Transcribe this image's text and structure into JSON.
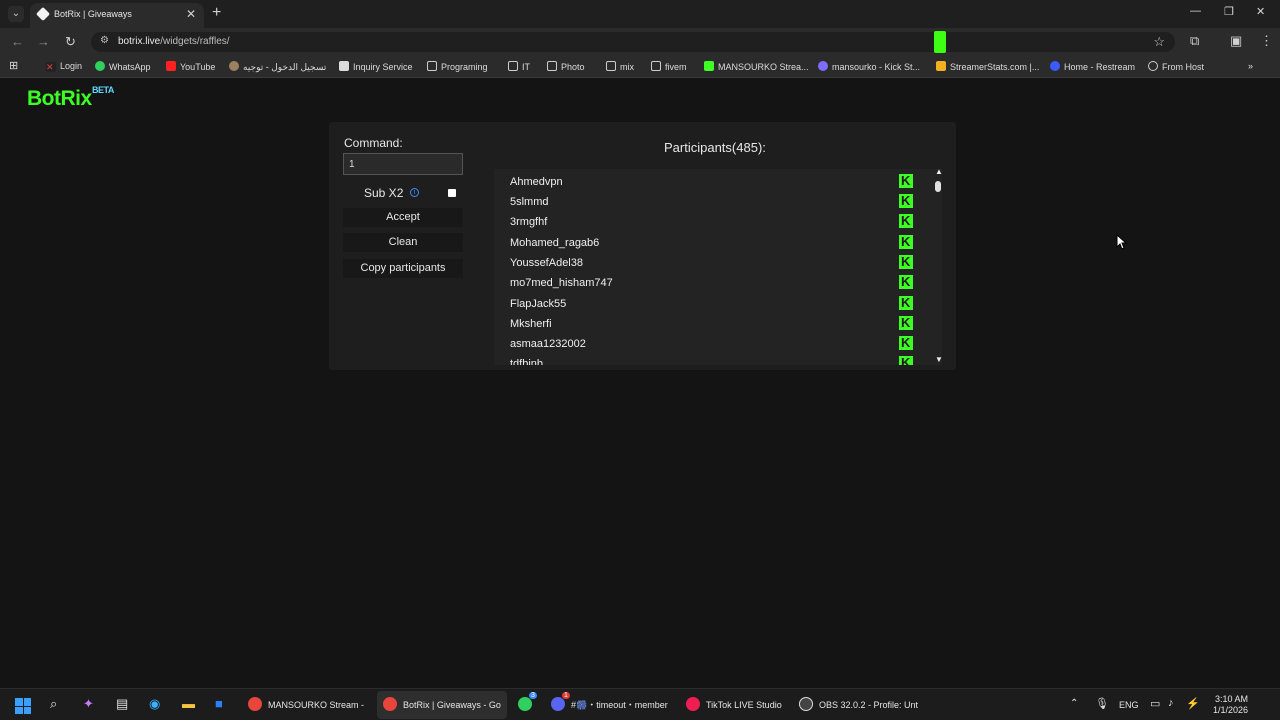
{
  "browser": {
    "tab_title": "BotRix | Giveaways",
    "url_domain": "botrix.live",
    "url_path": "/widgets/raffles/",
    "bookmarks": [
      "Login",
      "WhatsApp",
      "YouTube",
      "تسجيل الدخول - توجيه",
      "Inquiry Service",
      "Programing",
      "IT",
      "Photo",
      "mix",
      "fivem",
      "MANSOURKO Strea...",
      "mansourko - Kick St...",
      "StreamerStats.com |...",
      "Home - Restream",
      "From Host"
    ]
  },
  "page": {
    "logo": "BotRix",
    "logo_badge": "BETA",
    "command_label": "Command:",
    "command_value": "1",
    "sub_label": "Sub X2",
    "info_icon": "i",
    "accept_label": "Accept",
    "clean_label": "Clean",
    "copy_label": "Copy participants",
    "participants_title": "Participants(485):",
    "participants": [
      "Ahmedvpn",
      "5slmmd",
      "3rmgfhf",
      "Mohamed_ragab6",
      "YoussefAdel38",
      "mo7med_hisham747",
      "FlapJack55",
      "Mksherfi",
      "asmaa1232002",
      "tdfbjnb"
    ]
  },
  "taskbar": {
    "apps": [
      "MANSOURKO Stream -",
      "BotRix | Giveaways - Go",
      "#⁠🎆・timeout・member",
      "TikTok LIVE Studio",
      "OBS 32.0.2 - Profile: Unt"
    ],
    "whatsapp_badge": "3",
    "discord_badge": "1",
    "lang": "ENG",
    "time": "3:10 AM",
    "date": "1/1/2026"
  },
  "colors": {
    "accent": "#3dff24",
    "beta": "#5fd8ff"
  }
}
